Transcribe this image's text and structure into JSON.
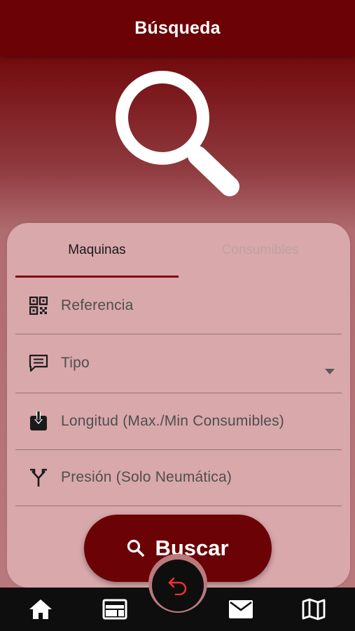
{
  "header": {
    "title": "Búsqueda"
  },
  "hero": {
    "icon": "magnifier-icon"
  },
  "tabs": [
    {
      "label": "Maquinas",
      "active": true
    },
    {
      "label": "Consumibles",
      "active": false
    }
  ],
  "fields": {
    "referencia": {
      "placeholder": "Referencia",
      "icon": "qr-code-icon"
    },
    "tipo": {
      "placeholder": "Tipo",
      "icon": "message-icon"
    },
    "longitud": {
      "placeholder": "Longitud (Max./Min Consumibles)",
      "icon": "download-box-icon"
    },
    "presion": {
      "placeholder": "Presión (Solo Neumática)",
      "icon": "fork-icon"
    }
  },
  "search_button": {
    "label": "Buscar",
    "icon": "search-icon"
  },
  "bottom_nav": {
    "items": [
      "home-icon",
      "web-icon",
      "mail-icon",
      "map-icon"
    ],
    "fab_icon": "back-arrow-icon"
  },
  "colors": {
    "primary": "#6b0306",
    "card": "#d9a8ab",
    "tab_indicator": "#7a0a0e",
    "fab_icon": "#e8322e",
    "bottom_bar": "#0e0e0e"
  }
}
